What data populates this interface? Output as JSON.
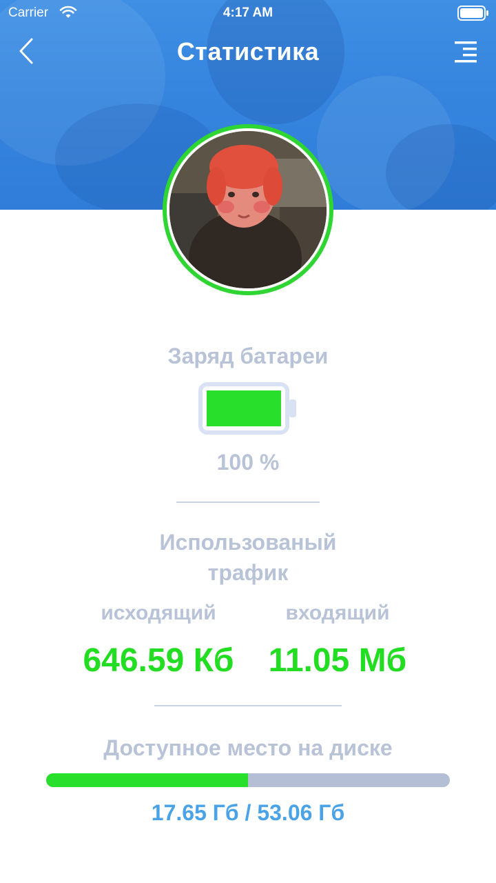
{
  "status_bar": {
    "carrier": "Carrier",
    "time": "4:17 AM"
  },
  "nav": {
    "title": "Статистика",
    "back_icon": "chevron-left-icon",
    "menu_icon": "menu-icon"
  },
  "colors": {
    "header": "#3585df",
    "accent_green": "#28df2b",
    "label_gray": "#b8c3d8",
    "disk_text_blue": "#4aa3e6"
  },
  "battery": {
    "label": "Заряд батареи",
    "percent_text": "100 %",
    "level": 1.0
  },
  "traffic": {
    "title_line1": "Использованый",
    "title_line2": "трафик",
    "outgoing_label": "исходящий",
    "outgoing_value": "646.59 Кб",
    "incoming_label": "входящий",
    "incoming_value": "11.05 Мб"
  },
  "disk": {
    "label": "Доступное место на диске",
    "text": "17.65 Гб / 53.06 Гб",
    "fraction": 0.5
  }
}
